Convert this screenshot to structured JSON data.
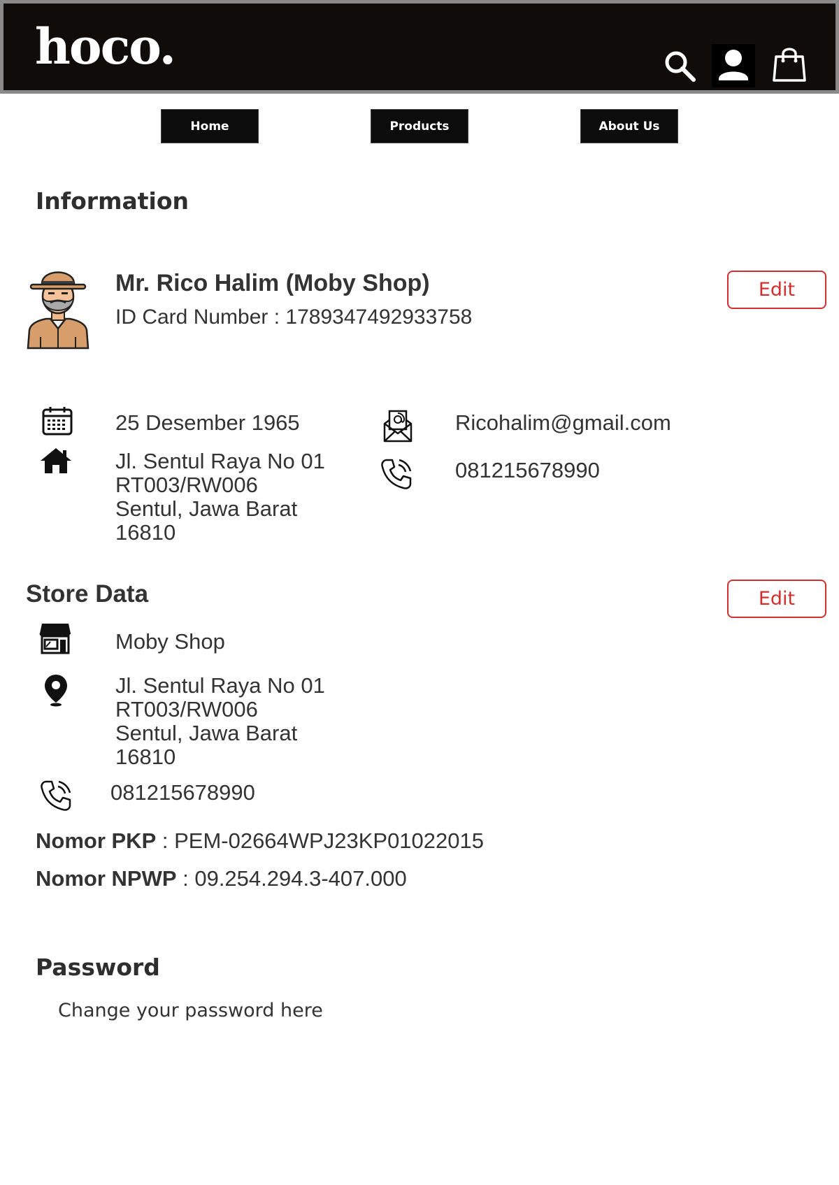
{
  "header": {
    "logo": "hoco.",
    "icons": [
      "search-icon",
      "user-icon",
      "shopping-bag-icon"
    ]
  },
  "nav": {
    "items": [
      {
        "label": "Home"
      },
      {
        "label": "Products"
      },
      {
        "label": "About Us"
      }
    ]
  },
  "information": {
    "title": "Information",
    "name": "Mr. Rico Halim (Moby Shop)",
    "id_label": "ID Card Number : ",
    "id_value": "1789347492933758",
    "edit_label": "Edit",
    "birth_date": "25 Desember 1965",
    "address_lines": [
      "Jl. Sentul Raya No 01",
      "RT003/RW006",
      "Sentul, Jawa Barat",
      "16810"
    ],
    "email": "Ricohalim@gmail.com",
    "phone": "081215678990"
  },
  "store": {
    "title": "Store Data",
    "edit_label": "Edit",
    "name": "Moby Shop",
    "address_lines": [
      "Jl. Sentul Raya No 01",
      "RT003/RW006",
      "Sentul, Jawa Barat",
      "16810"
    ],
    "phone": "081215678990",
    "pkp_label": "Nomor PKP",
    "pkp_value": " : PEM-02664WPJ23KP01022015",
    "npwp_label": "Nomor NPWP",
    "npwp_value": " : 09.254.294.3-407.000"
  },
  "password": {
    "title": "Password",
    "link": "Change your password here"
  },
  "colors": {
    "header_bg": "#0f0c09",
    "edit_accent": "#d32f2f",
    "nav_bg": "#0c0c0c"
  }
}
